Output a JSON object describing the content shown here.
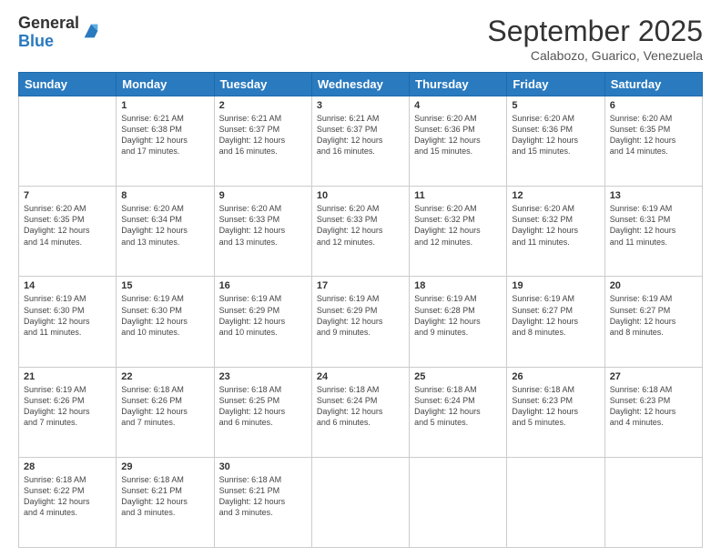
{
  "logo": {
    "general": "General",
    "blue": "Blue"
  },
  "header": {
    "month": "September 2025",
    "location": "Calabozo, Guarico, Venezuela"
  },
  "days_of_week": [
    "Sunday",
    "Monday",
    "Tuesday",
    "Wednesday",
    "Thursday",
    "Friday",
    "Saturday"
  ],
  "weeks": [
    [
      {
        "day": "",
        "info": ""
      },
      {
        "day": "1",
        "info": "Sunrise: 6:21 AM\nSunset: 6:38 PM\nDaylight: 12 hours\nand 17 minutes."
      },
      {
        "day": "2",
        "info": "Sunrise: 6:21 AM\nSunset: 6:37 PM\nDaylight: 12 hours\nand 16 minutes."
      },
      {
        "day": "3",
        "info": "Sunrise: 6:21 AM\nSunset: 6:37 PM\nDaylight: 12 hours\nand 16 minutes."
      },
      {
        "day": "4",
        "info": "Sunrise: 6:20 AM\nSunset: 6:36 PM\nDaylight: 12 hours\nand 15 minutes."
      },
      {
        "day": "5",
        "info": "Sunrise: 6:20 AM\nSunset: 6:36 PM\nDaylight: 12 hours\nand 15 minutes."
      },
      {
        "day": "6",
        "info": "Sunrise: 6:20 AM\nSunset: 6:35 PM\nDaylight: 12 hours\nand 14 minutes."
      }
    ],
    [
      {
        "day": "7",
        "info": "Sunrise: 6:20 AM\nSunset: 6:35 PM\nDaylight: 12 hours\nand 14 minutes."
      },
      {
        "day": "8",
        "info": "Sunrise: 6:20 AM\nSunset: 6:34 PM\nDaylight: 12 hours\nand 13 minutes."
      },
      {
        "day": "9",
        "info": "Sunrise: 6:20 AM\nSunset: 6:33 PM\nDaylight: 12 hours\nand 13 minutes."
      },
      {
        "day": "10",
        "info": "Sunrise: 6:20 AM\nSunset: 6:33 PM\nDaylight: 12 hours\nand 12 minutes."
      },
      {
        "day": "11",
        "info": "Sunrise: 6:20 AM\nSunset: 6:32 PM\nDaylight: 12 hours\nand 12 minutes."
      },
      {
        "day": "12",
        "info": "Sunrise: 6:20 AM\nSunset: 6:32 PM\nDaylight: 12 hours\nand 11 minutes."
      },
      {
        "day": "13",
        "info": "Sunrise: 6:19 AM\nSunset: 6:31 PM\nDaylight: 12 hours\nand 11 minutes."
      }
    ],
    [
      {
        "day": "14",
        "info": "Sunrise: 6:19 AM\nSunset: 6:30 PM\nDaylight: 12 hours\nand 11 minutes."
      },
      {
        "day": "15",
        "info": "Sunrise: 6:19 AM\nSunset: 6:30 PM\nDaylight: 12 hours\nand 10 minutes."
      },
      {
        "day": "16",
        "info": "Sunrise: 6:19 AM\nSunset: 6:29 PM\nDaylight: 12 hours\nand 10 minutes."
      },
      {
        "day": "17",
        "info": "Sunrise: 6:19 AM\nSunset: 6:29 PM\nDaylight: 12 hours\nand 9 minutes."
      },
      {
        "day": "18",
        "info": "Sunrise: 6:19 AM\nSunset: 6:28 PM\nDaylight: 12 hours\nand 9 minutes."
      },
      {
        "day": "19",
        "info": "Sunrise: 6:19 AM\nSunset: 6:27 PM\nDaylight: 12 hours\nand 8 minutes."
      },
      {
        "day": "20",
        "info": "Sunrise: 6:19 AM\nSunset: 6:27 PM\nDaylight: 12 hours\nand 8 minutes."
      }
    ],
    [
      {
        "day": "21",
        "info": "Sunrise: 6:19 AM\nSunset: 6:26 PM\nDaylight: 12 hours\nand 7 minutes."
      },
      {
        "day": "22",
        "info": "Sunrise: 6:18 AM\nSunset: 6:26 PM\nDaylight: 12 hours\nand 7 minutes."
      },
      {
        "day": "23",
        "info": "Sunrise: 6:18 AM\nSunset: 6:25 PM\nDaylight: 12 hours\nand 6 minutes."
      },
      {
        "day": "24",
        "info": "Sunrise: 6:18 AM\nSunset: 6:24 PM\nDaylight: 12 hours\nand 6 minutes."
      },
      {
        "day": "25",
        "info": "Sunrise: 6:18 AM\nSunset: 6:24 PM\nDaylight: 12 hours\nand 5 minutes."
      },
      {
        "day": "26",
        "info": "Sunrise: 6:18 AM\nSunset: 6:23 PM\nDaylight: 12 hours\nand 5 minutes."
      },
      {
        "day": "27",
        "info": "Sunrise: 6:18 AM\nSunset: 6:23 PM\nDaylight: 12 hours\nand 4 minutes."
      }
    ],
    [
      {
        "day": "28",
        "info": "Sunrise: 6:18 AM\nSunset: 6:22 PM\nDaylight: 12 hours\nand 4 minutes."
      },
      {
        "day": "29",
        "info": "Sunrise: 6:18 AM\nSunset: 6:21 PM\nDaylight: 12 hours\nand 3 minutes."
      },
      {
        "day": "30",
        "info": "Sunrise: 6:18 AM\nSunset: 6:21 PM\nDaylight: 12 hours\nand 3 minutes."
      },
      {
        "day": "",
        "info": ""
      },
      {
        "day": "",
        "info": ""
      },
      {
        "day": "",
        "info": ""
      },
      {
        "day": "",
        "info": ""
      }
    ]
  ]
}
